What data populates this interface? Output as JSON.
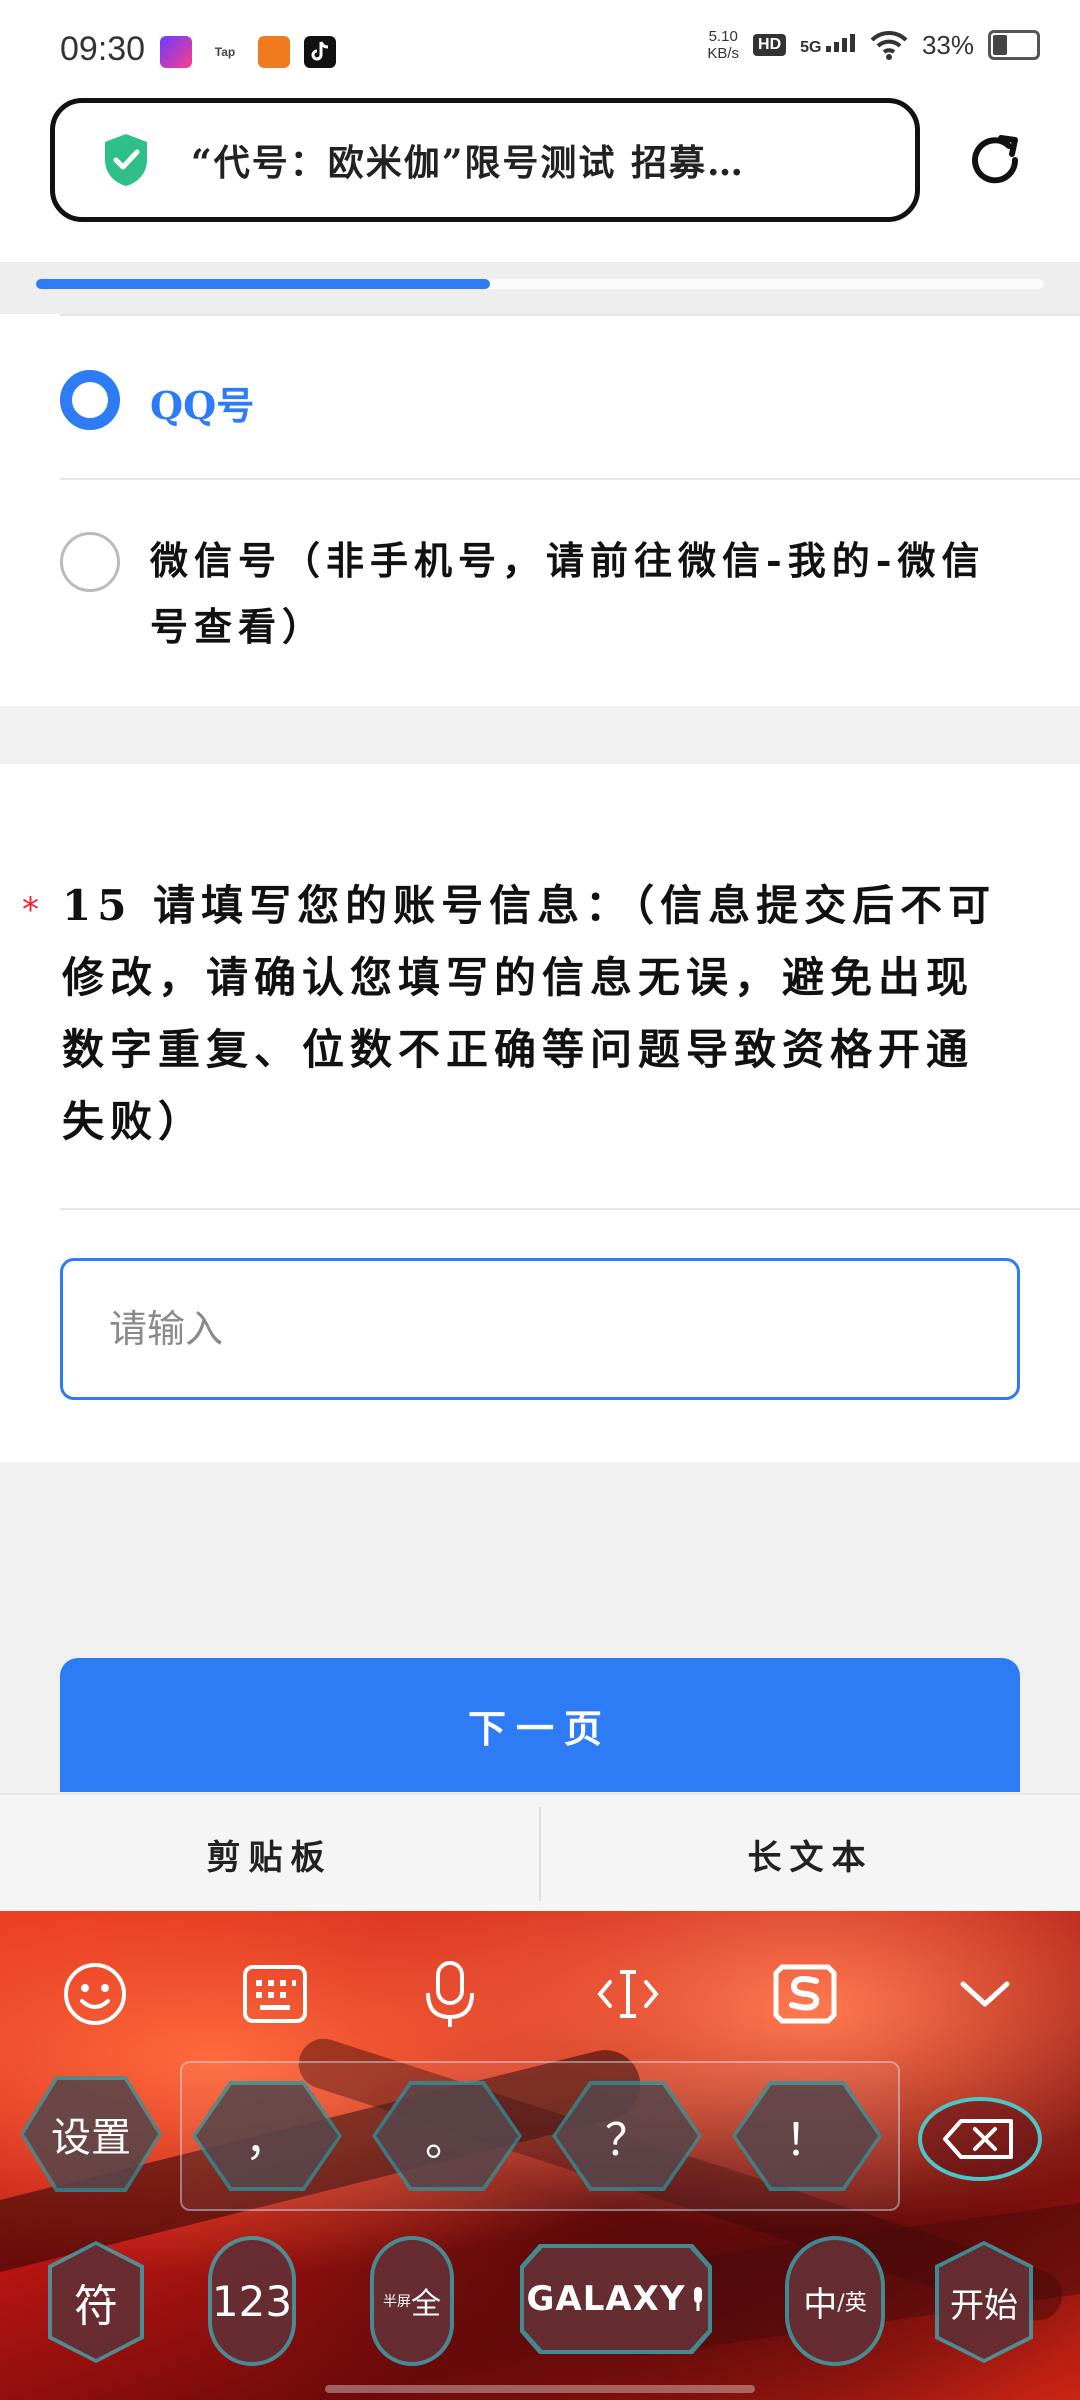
{
  "status_bar": {
    "time": "09:30",
    "app_icons": [
      "app-icon-1",
      "Tap",
      "app-icon-3",
      "tiktok-icon"
    ],
    "tap_label": "Tap",
    "net_speed_value": "5.10",
    "net_speed_unit": "KB/s",
    "hd_badge": "HD",
    "network": "5G",
    "battery": "33%"
  },
  "browser": {
    "url_title": "“代号：欧米伽”限号测试 招募…",
    "page_load_progress": 0.45
  },
  "survey": {
    "options": [
      {
        "label": "QQ号",
        "selected": true
      },
      {
        "label": "微信号（非手机号，请前往微信-我的-微信号查看）",
        "selected": false
      }
    ],
    "question": {
      "required_mark": "*",
      "text": "15 请填写您的账号信息：（信息提交后不可修改，请确认您填写的信息无误，避免出现数字重复、位数不正确等问题导致资格开通失败）"
    },
    "input_placeholder": "请输入",
    "next_button": "下一页"
  },
  "keyboard": {
    "toolbar": {
      "clipboard": "剪贴板",
      "long_text": "长文本"
    },
    "punctuation_keys": [
      "，",
      "。",
      "？",
      "！"
    ],
    "settings_key": "设置",
    "bottom_keys": {
      "symbols": "符",
      "numbers": "123",
      "half_full_small": "半屏",
      "half_full_big": "全",
      "space_brand": "GALAXY",
      "lang_zh": "中",
      "lang_en": "/英",
      "start": "开始"
    },
    "colors": {
      "accent": "#2d7cf6",
      "key_glow": "#3cb4b4"
    }
  }
}
